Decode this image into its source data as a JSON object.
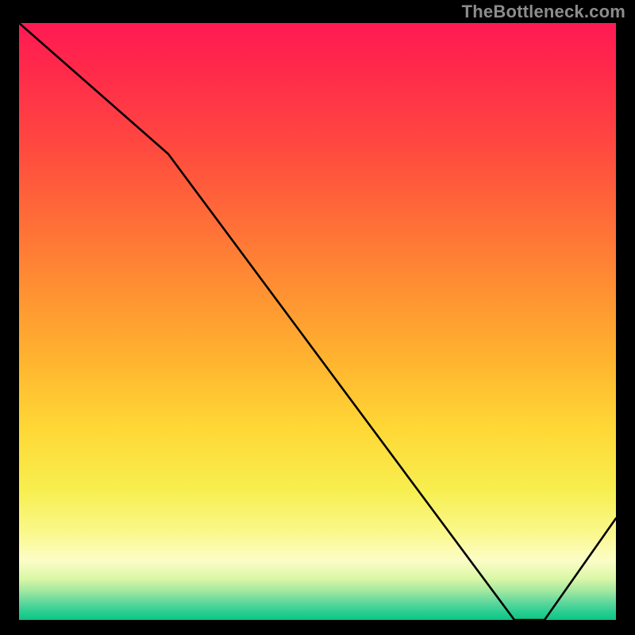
{
  "watermark": "TheBottleneck.com",
  "annotation": "",
  "chart_data": {
    "type": "line",
    "title": "",
    "xlabel": "",
    "ylabel": "",
    "x": [
      0,
      25,
      83,
      88,
      100
    ],
    "values": [
      100,
      78,
      0,
      0,
      17
    ],
    "xlim": [
      0,
      100
    ],
    "ylim": [
      0,
      100
    ],
    "grid": false,
    "legend": false,
    "background": "red-yellow-green vertical gradient",
    "notes": "y represents distance from optimum (0 = best/green at bottom, 100 = worst/red at top). Optimum flat region roughly x 83–88."
  }
}
